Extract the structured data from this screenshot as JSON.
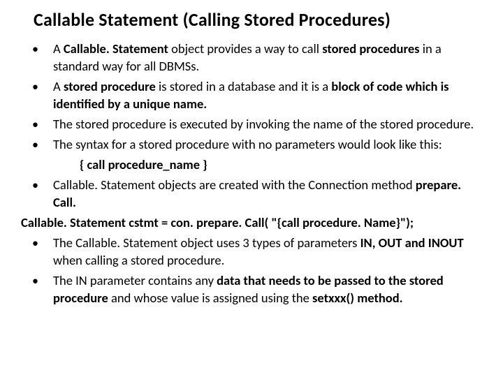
{
  "title": "Callable Statement (Calling Stored Procedures)",
  "items": [
    {
      "type": "bullet",
      "segments": [
        {
          "t": "A "
        },
        {
          "t": "Callable. Statement",
          "b": true
        },
        {
          "t": " object provides a way to call "
        },
        {
          "t": "stored procedures",
          "b": true
        },
        {
          "t": " in a standard way for all DBMSs."
        }
      ]
    },
    {
      "type": "bullet",
      "segments": [
        {
          "t": " A "
        },
        {
          "t": "stored procedure",
          "b": true
        },
        {
          "t": " is stored in a database and it is a "
        },
        {
          "t": "block of code which is identified by a unique name.",
          "b": true
        }
      ]
    },
    {
      "type": "bullet",
      "segments": [
        {
          "t": "The stored procedure is executed by invoking the name of the stored procedure."
        }
      ]
    },
    {
      "type": "bullet",
      "segments": [
        {
          "t": "The syntax for a stored procedure with no parameters would look like this:"
        }
      ]
    },
    {
      "type": "center",
      "segments": [
        {
          "t": "{ call  procedure_name }",
          "b": true
        }
      ]
    },
    {
      "type": "bullet",
      "segments": [
        {
          "t": "Callable. Statement objects are created with the Connection method "
        },
        {
          "t": "prepare. Call.",
          "b": true
        }
      ]
    },
    {
      "type": "flush",
      "segments": [
        {
          "t": "Callable. Statement  cstmt = con. prepare. Call( \"{call  procedure. Name}\");",
          "b": true
        }
      ]
    },
    {
      "type": "bullet",
      "segments": [
        {
          "t": "The Callable. Statement object uses 3 types of parameters "
        },
        {
          "t": "IN, OUT and INOUT",
          "b": true
        },
        {
          "t": " when calling a stored procedure."
        }
      ]
    },
    {
      "type": "bullet",
      "segments": [
        {
          "t": "The IN parameter contains any "
        },
        {
          "t": "data that needs to be passed to the stored procedure",
          "b": true
        },
        {
          "t": " and whose value is assigned using the "
        },
        {
          "t": "setxxx() method.",
          "b": true
        }
      ]
    }
  ]
}
